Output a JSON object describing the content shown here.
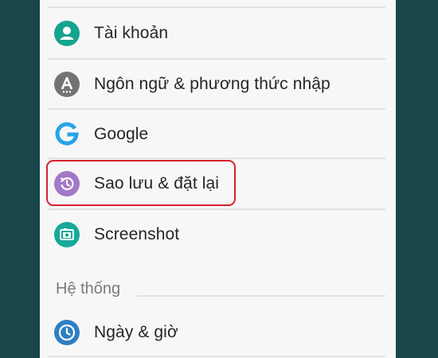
{
  "settings": {
    "items": [
      {
        "label": "Tài khoản",
        "icon": "account-icon",
        "icon_color": "#16a38f"
      },
      {
        "label": "Ngôn ngữ & phương thức nhập",
        "icon": "language-input-icon",
        "icon_color": "#737373"
      },
      {
        "label": "Google",
        "icon": "google-icon",
        "icon_color": "#2aa4e6"
      },
      {
        "label": "Sao lưu & đặt lại",
        "icon": "backup-reset-icon",
        "icon_color": "#a378c7"
      },
      {
        "label": "Screenshot",
        "icon": "screenshot-icon",
        "icon_color": "#18a89a"
      }
    ],
    "system_section": {
      "title": "Hệ thống",
      "items": [
        {
          "label": "Ngày & giờ",
          "icon": "clock-icon",
          "icon_color": "#2f7fc2"
        }
      ]
    }
  },
  "colors": {
    "background": "#1a454b",
    "panel": "#f7f7f7",
    "highlight_border": "#d7212f"
  }
}
